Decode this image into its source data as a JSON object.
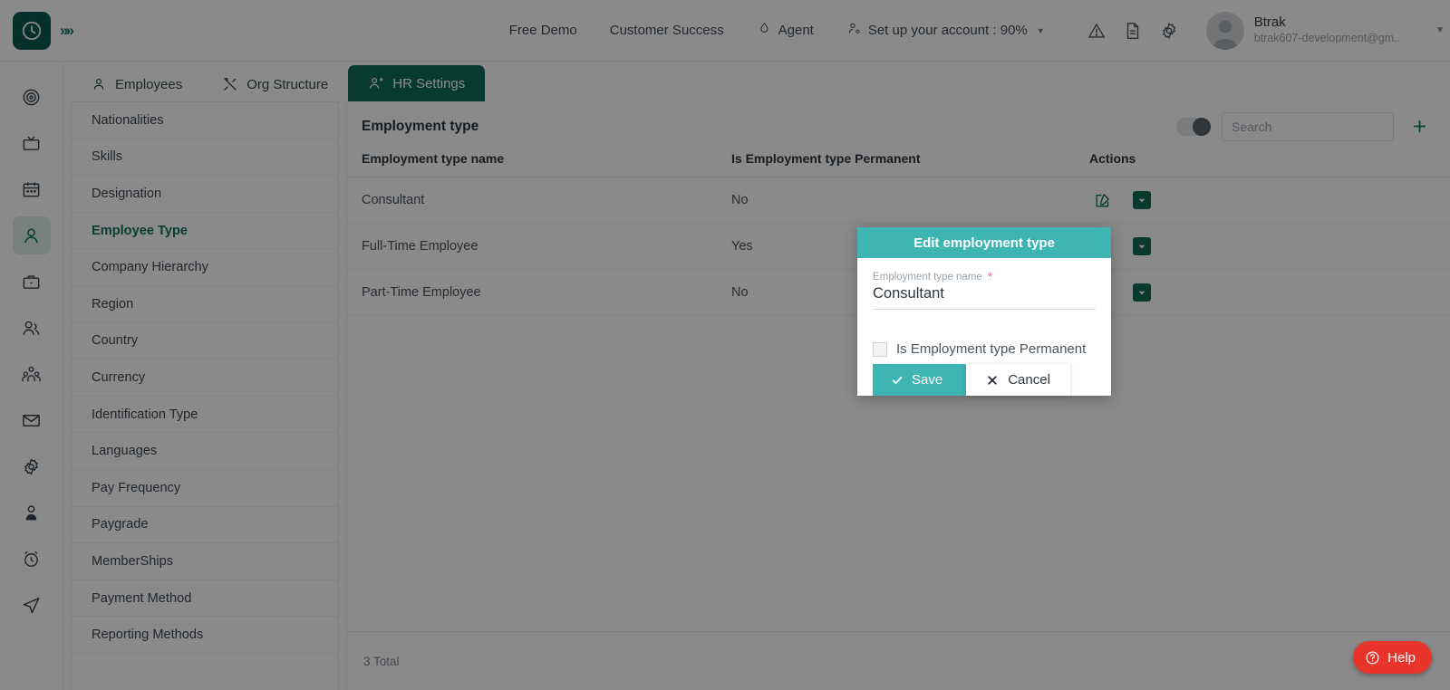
{
  "header": {
    "logo_icon": "clock-logo-icon",
    "expand_icon": "chevrons-right-icon",
    "links": [
      {
        "label": "Free Demo",
        "icon": null
      },
      {
        "label": "Customer Success",
        "icon": null
      },
      {
        "label": "Agent",
        "icon": "agent-icon"
      }
    ],
    "account_setup": {
      "label": "Set up your account : 90%",
      "icon": "account-setup-icon",
      "caret": "▼"
    },
    "icons": [
      "warning-icon",
      "document-icon",
      "gear-icon"
    ],
    "profile": {
      "name": "Btrak",
      "email": "btrak607-development@gm..",
      "caret": "▼"
    }
  },
  "tabs": [
    {
      "label": "Employees",
      "icon": "person-icon",
      "active": false
    },
    {
      "label": "Org Structure",
      "icon": "tools-icon",
      "active": false
    },
    {
      "label": "HR Settings",
      "icon": "people-settings-icon",
      "active": true
    }
  ],
  "subnav": {
    "items": [
      {
        "label": "Nationalities",
        "active": false
      },
      {
        "label": "Skills",
        "active": false
      },
      {
        "label": "Designation",
        "active": false
      },
      {
        "label": "Employee Type",
        "active": true
      },
      {
        "label": "Company Hierarchy",
        "active": false
      },
      {
        "label": "Region",
        "active": false
      },
      {
        "label": "Country",
        "active": false
      },
      {
        "label": "Currency",
        "active": false
      },
      {
        "label": "Identification Type",
        "active": false
      },
      {
        "label": "Languages",
        "active": false
      },
      {
        "label": "Pay Frequency",
        "active": false
      },
      {
        "label": "Paygrade",
        "active": false
      },
      {
        "label": "MemberShips",
        "active": false
      },
      {
        "label": "Payment Method",
        "active": false
      },
      {
        "label": "Reporting Methods",
        "active": false
      }
    ]
  },
  "rail": {
    "items": [
      {
        "icon": "target-icon",
        "active": false
      },
      {
        "icon": "tv-icon",
        "active": false
      },
      {
        "icon": "calendar-icon",
        "active": false
      },
      {
        "icon": "user-icon",
        "active": true
      },
      {
        "icon": "briefcase-icon",
        "active": false
      },
      {
        "icon": "users-icon",
        "active": false
      },
      {
        "icon": "team-icon",
        "active": false
      },
      {
        "icon": "mail-icon",
        "active": false
      },
      {
        "icon": "gear-icon",
        "active": false
      },
      {
        "icon": "profile-icon",
        "active": false
      },
      {
        "icon": "alarm-icon",
        "active": false
      },
      {
        "icon": "send-icon",
        "active": false
      }
    ]
  },
  "main": {
    "title": "Employment type",
    "search_placeholder": "Search",
    "search_value": "",
    "toggle_on": false,
    "add_label": "+",
    "columns": [
      "Employment type name",
      "Is Employment type Permanent",
      "Actions"
    ],
    "rows": [
      {
        "name": "Consultant",
        "permanent": "No",
        "edit_icon": "edit-icon",
        "archive_icon": "archive-icon"
      },
      {
        "name": "Full-Time Employee",
        "permanent": "Yes",
        "edit_icon": "edit-icon",
        "archive_icon": "archive-icon"
      },
      {
        "name": "Part-Time Employee",
        "permanent": "No",
        "edit_icon": "edit-icon",
        "archive_icon": "archive-icon"
      }
    ],
    "total_text": "3 Total"
  },
  "modal": {
    "title": "Edit employment type",
    "field_label": "Employment type name",
    "required_mark": "*",
    "field_value": "Consultant",
    "checkbox_label": "Is Employment type Permanent",
    "checkbox_checked": false,
    "save_label": "Save",
    "cancel_label": "Cancel",
    "accent_color": "#3fb5b3"
  },
  "help": {
    "label": "Help",
    "icon": "question-circle-icon",
    "color": "#e8342b"
  }
}
